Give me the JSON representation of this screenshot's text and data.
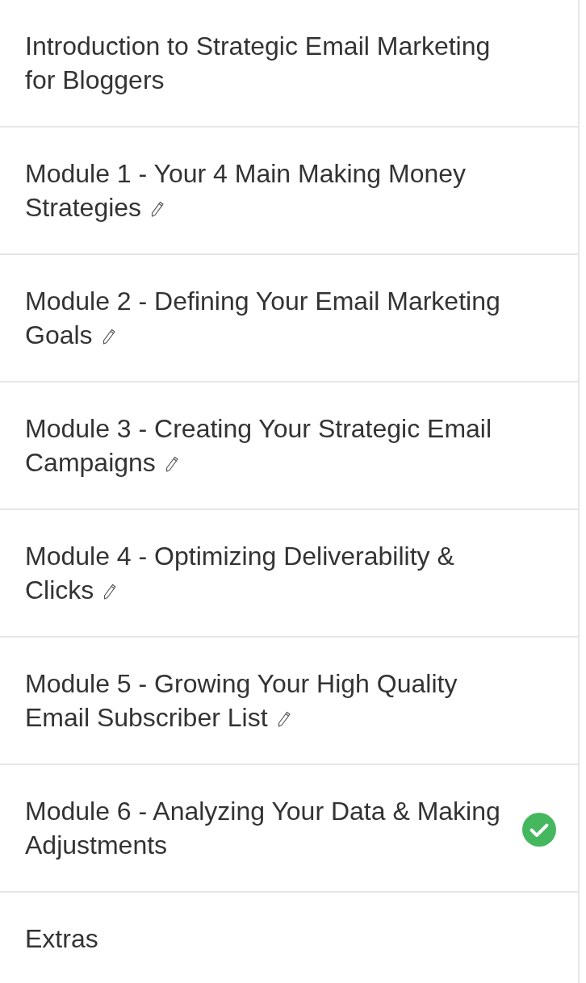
{
  "modules": [
    {
      "title": "Introduction to Strategic Email Marketing for Bloggers",
      "kind": "plain"
    },
    {
      "title": "Module 1 - Your 4 Main Making Money Strategies",
      "kind": "pencil"
    },
    {
      "title": "Module 2 - Defining Your Email Marketing Goals",
      "kind": "pencil"
    },
    {
      "title": "Module 3 - Creating Your Strategic Email Campaigns",
      "kind": "pencil"
    },
    {
      "title": "Module 4 - Optimizing Deliverability & Clicks",
      "kind": "pencil"
    },
    {
      "title": "Module 5 - Growing Your High Quality Email Subscriber List",
      "kind": "pencil"
    },
    {
      "title": "Module 6 - Analyzing Your Data & Making Adjustments",
      "kind": "check"
    },
    {
      "title": "Extras",
      "kind": "plain"
    }
  ]
}
